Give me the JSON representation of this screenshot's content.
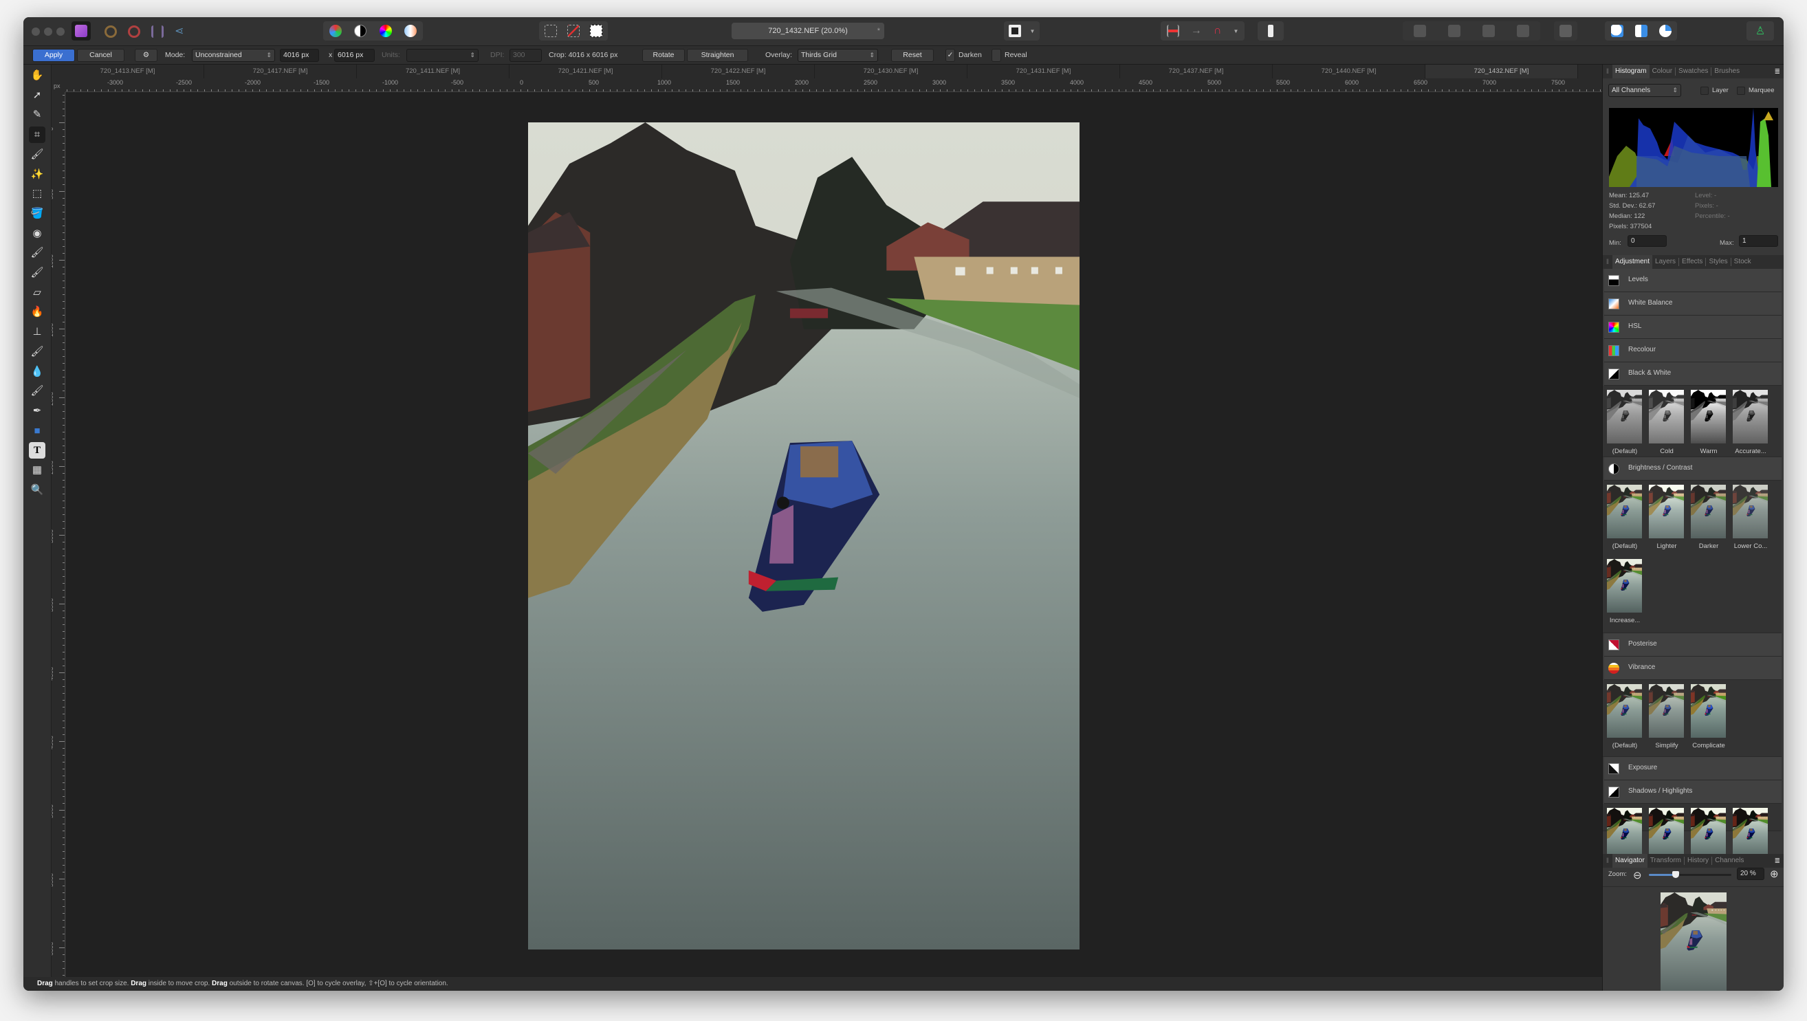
{
  "titlebar": {
    "document_title": "720_1432.NEF (20.0%)",
    "close_mark": "*"
  },
  "context_toolbar": {
    "apply": "Apply",
    "cancel": "Cancel",
    "mode_label": "Mode:",
    "mode_value": "Unconstrained",
    "width": "4016 px",
    "times": "x",
    "height": "6016 px",
    "units_label": "Units:",
    "units_value": "",
    "dpi_label": "DPI:",
    "dpi_value": "300",
    "crop_info": "Crop: 4016 x 6016 px",
    "rotate": "Rotate",
    "straighten": "Straighten",
    "overlay_label": "Overlay:",
    "overlay_value": "Thirds Grid",
    "reset": "Reset",
    "darken": "Darken",
    "darken_checked": true,
    "reveal": "Reveal",
    "reveal_checked": false
  },
  "document_tabs": [
    "720_1413.NEF [M]",
    "720_1417.NEF [M]",
    "720_1411.NEF [M]",
    "720_1421.NEF [M]",
    "720_1422.NEF [M]",
    "720_1430.NEF [M]",
    "720_1431.NEF [M]",
    "720_1437.NEF [M]",
    "720_1440.NEF [M]",
    "720_1432.NEF [M]"
  ],
  "active_document_tab": 9,
  "rulers": {
    "unit": "px",
    "horizontal": [
      "-3000",
      "-2500",
      "-2000",
      "-1500",
      "-1000",
      "-500",
      "0",
      "500",
      "1000",
      "1500",
      "2000",
      "2500",
      "3000",
      "3500",
      "4000",
      "4500",
      "5000",
      "5500",
      "6000",
      "6500",
      "7000",
      "7500"
    ],
    "vertical": [
      "0",
      "500",
      "1000",
      "1500",
      "2000",
      "2500",
      "3000",
      "3500",
      "4000",
      "4500",
      "5000",
      "5500",
      "6000"
    ]
  },
  "tools": [
    "hand-tool",
    "move-tool",
    "color-picker-tool",
    "crop-tool",
    "selection-brush-tool",
    "flood-select-tool",
    "marquee-tool",
    "flood-fill-tool",
    "color-wheel",
    "paint-brush-tool",
    "smudge-brush-tool",
    "erase-tool",
    "burn-tool",
    "clone-tool",
    "healing-brush-tool",
    "blur-tool",
    "inpainting-tool",
    "pen-tool",
    "rectangle-tool",
    "text-tool",
    "mesh-warp-tool",
    "zoom-tool"
  ],
  "active_tool": "crop-tool",
  "status": {
    "b1": "Drag",
    "t1": " handles to set crop size. ",
    "b2": "Drag",
    "t2": " inside to move crop. ",
    "b3": "Drag",
    "t3": " outside to rotate canvas. [O] to cycle overlay, ⇧+[O] to cycle orientation."
  },
  "histogram_panel": {
    "tabs": [
      "Histogram",
      "Colour",
      "Swatches",
      "Brushes"
    ],
    "channel": "All Channels",
    "layer": "Layer",
    "marquee": "Marquee",
    "mean": "Mean: 125.47",
    "std_dev": "Std. Dev.: 62.67",
    "median": "Median: 122",
    "pixels": "Pixels: 377504",
    "level": "Level: -",
    "pixels_r": "Pixels: -",
    "percentile": "Percentile: -",
    "min_label": "Min:",
    "min_value": "0",
    "max_label": "Max:",
    "max_value": "1",
    "warning_icon": "clipping-warning-icon"
  },
  "adjustment_panel": {
    "tabs": [
      "Adjustment",
      "Layers",
      "Effects",
      "Styles",
      "Stock"
    ],
    "items": {
      "levels": "Levels",
      "white_balance": "White Balance",
      "hsl": "HSL",
      "recolour": "Recolour",
      "black_white": "Black & White",
      "bw_presets": [
        "(Default)",
        "Cold",
        "Warm",
        "Accurate..."
      ],
      "brightness": "Brightness / Contrast",
      "bc_presets": [
        "(Default)",
        "Lighter",
        "Darker",
        "Lower Co...",
        "Increase..."
      ],
      "posterise": "Posterise",
      "vibrance": "Vibrance",
      "vib_presets": [
        "(Default)",
        "Simplify",
        "Complicate"
      ],
      "exposure": "Exposure",
      "shadows": "Shadows / Highlights"
    }
  },
  "navigator_panel": {
    "tabs": [
      "Navigator",
      "Transform",
      "History",
      "Channels"
    ],
    "zoom_label": "Zoom:",
    "zoom_value": "20 %",
    "zoom_percent": 20
  }
}
